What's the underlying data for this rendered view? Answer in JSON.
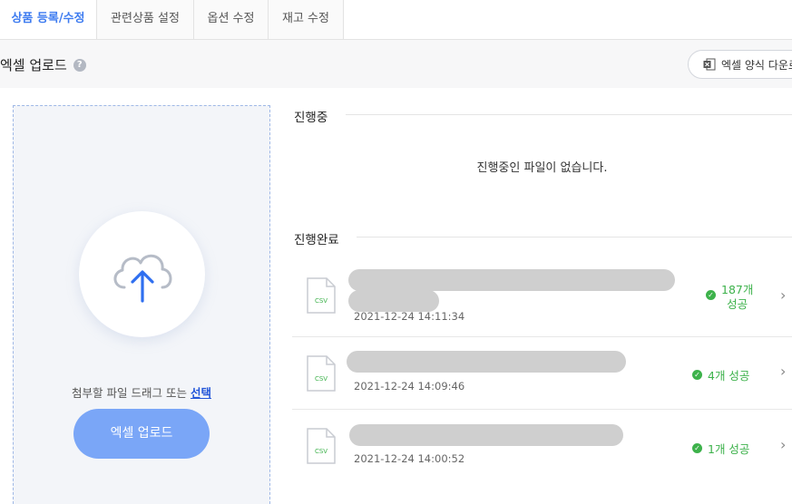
{
  "tabs": [
    {
      "label": "상품 등록/수정",
      "active": true
    },
    {
      "label": "관련상품 설정",
      "active": false
    },
    {
      "label": "옵션 수정",
      "active": false
    },
    {
      "label": "재고 수정",
      "active": false
    }
  ],
  "header": {
    "title": "엑셀 업로드",
    "help_icon": "?",
    "download_label": "엑셀 양식 다운로드"
  },
  "upload": {
    "hint_text": "첨부할 파일 드래그 또는 ",
    "hint_link": "선택",
    "button_label": "엑셀 업로드"
  },
  "in_progress": {
    "title": "진행중",
    "empty_message": "진행중인 파일이 없습니다."
  },
  "completed": {
    "title": "진행완료",
    "file_icon_label": "CSV",
    "items": [
      {
        "date": "2021-12-24 14:11:34",
        "status_count": "187개",
        "status_word": "성공"
      },
      {
        "date": "2021-12-24 14:09:46",
        "status": "4개 성공"
      },
      {
        "date": "2021-12-24 14:00:52",
        "status": "1개 성공"
      }
    ]
  },
  "colors": {
    "accent": "#3d7bf0",
    "upload_button": "#7aa6f7",
    "success": "#3db24b",
    "link": "#2356d9"
  }
}
